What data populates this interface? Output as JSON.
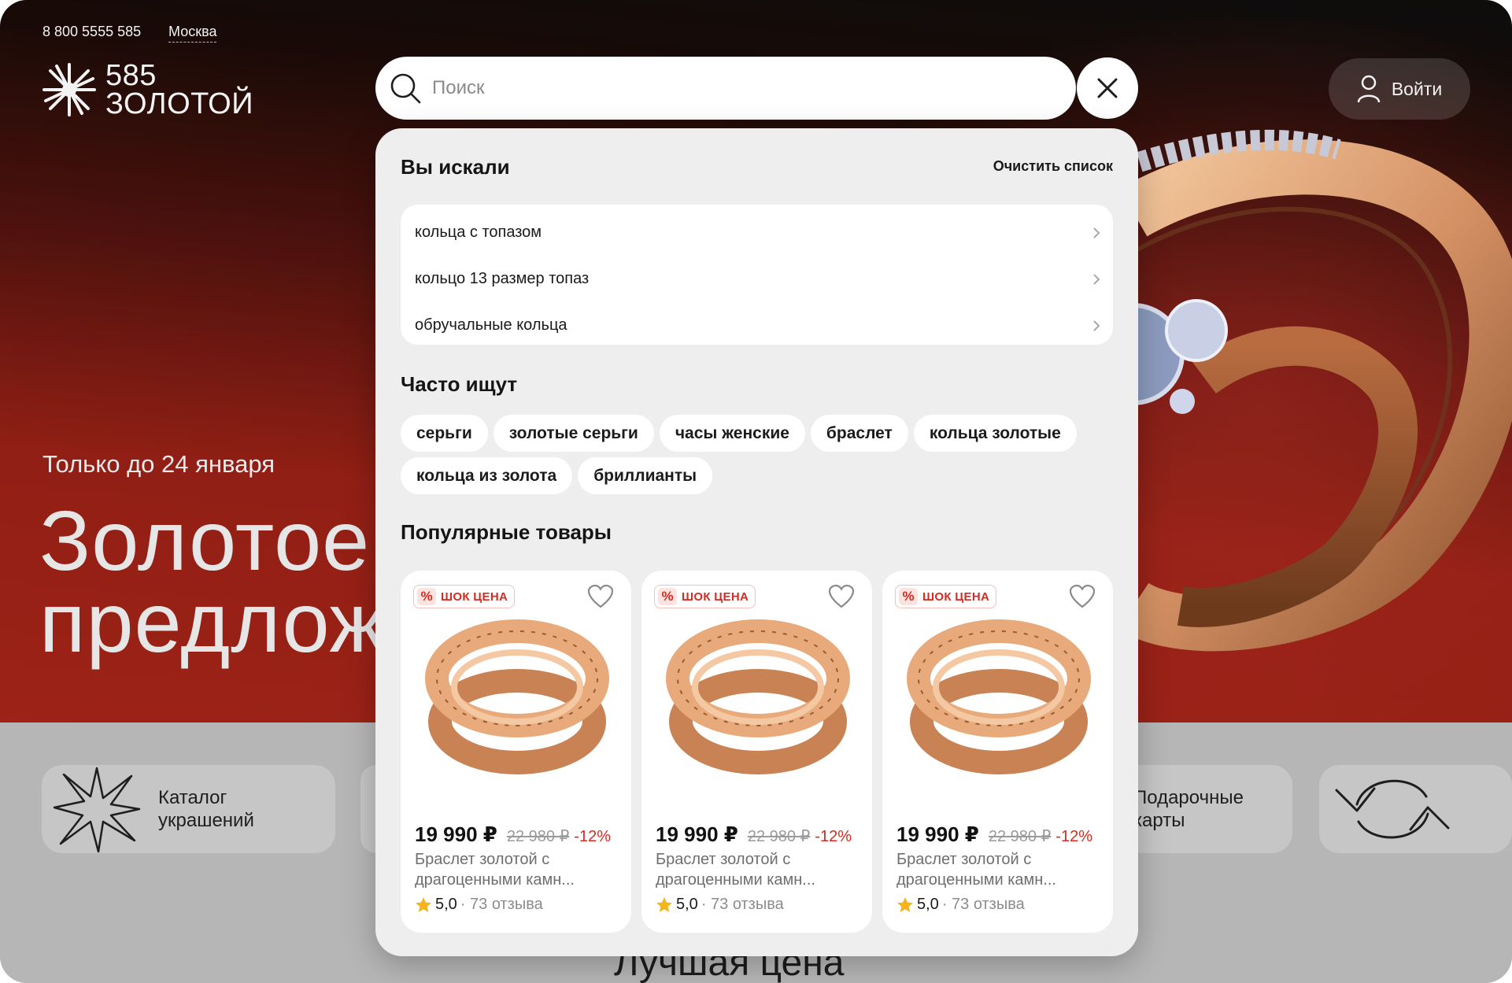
{
  "header": {
    "phone": "8 800 5555 585",
    "city": "Москва",
    "logo_number": "585",
    "logo_name": "ЗОЛОТОЙ",
    "login_label": "Войти"
  },
  "promo": {
    "date": "Только до 24 января",
    "title": "Золотое\nпредлож"
  },
  "tiles": {
    "catalog": "Каталог\nукрашений",
    "gift": "Подарочные\nкарты"
  },
  "bottom_caption": "Лучшая цена",
  "search": {
    "placeholder": "Поиск",
    "value": ""
  },
  "history": {
    "title": "Вы искали",
    "clear_label": "Очистить список",
    "items": [
      "кольца с топазом",
      "кольцо 13 размер топаз",
      "обручальные кольца"
    ]
  },
  "popular_queries": {
    "title": "Часто ищут",
    "chips": [
      "серьги",
      "золотые серьги",
      "часы женские",
      "браслет",
      "кольца золотые",
      "кольца из золота",
      "бриллианты"
    ]
  },
  "popular_products": {
    "title": "Популярные товары",
    "items": [
      {
        "badge_icon": "%",
        "badge": "ШОК ЦЕНА",
        "price": "19 990 ₽",
        "old_price": "22 980 ₽",
        "discount": "-12%",
        "name": "Браслет золотой с драгоценными камн...",
        "rating": "5,0",
        "reviews": "· 73 отзыва"
      },
      {
        "badge_icon": "%",
        "badge": "ШОК ЦЕНА",
        "price": "19 990 ₽",
        "old_price": "22 980 ₽",
        "discount": "-12%",
        "name": "Браслет золотой с драгоценными камн...",
        "rating": "5,0",
        "reviews": "· 73 отзыва"
      },
      {
        "badge_icon": "%",
        "badge": "ШОК ЦЕНА",
        "price": "19 990 ₽",
        "old_price": "22 980 ₽",
        "discount": "-12%",
        "name": "Браслет золотой с драгоценными камн...",
        "rating": "5,0",
        "reviews": "· 73 отзыва"
      }
    ]
  },
  "colors": {
    "accent_red": "#d62b21",
    "hero_red": "#b3271b",
    "star": "#f5b41c",
    "gold": "#d98a52"
  },
  "icons": {
    "search": "search-icon",
    "close": "close-icon",
    "user": "user-icon",
    "chevron": "chevron-right-icon",
    "heart": "heart-icon",
    "star": "star-icon",
    "logo": "starburst-logo-icon",
    "exchange": "exchange-arrows-icon"
  }
}
